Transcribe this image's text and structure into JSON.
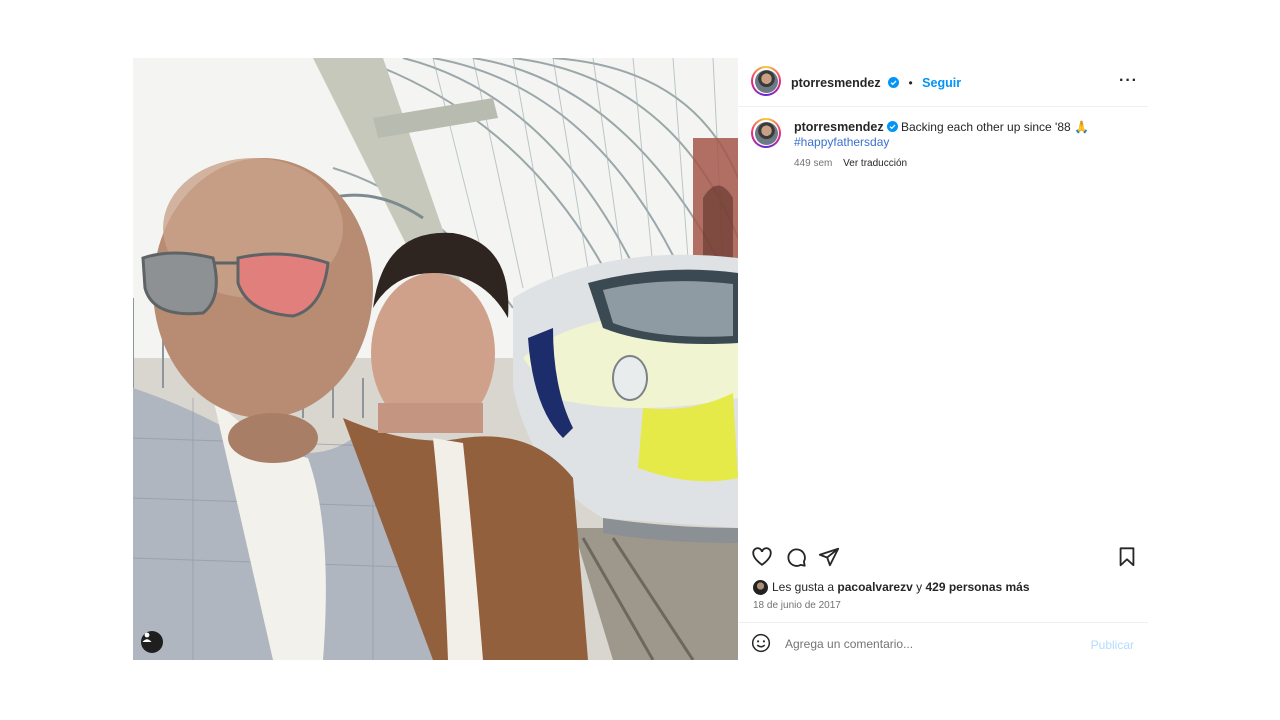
{
  "post": {
    "author": {
      "username": "ptorresmendez",
      "verified": true,
      "follow_label": "Seguir",
      "separator": "•"
    },
    "caption": {
      "text": "Backing each other up since '88 🙏",
      "hashtag": "#happyfathersday",
      "age": "449 sem",
      "translate_label": "Ver traducción"
    },
    "likes": {
      "prefix": "Les gusta a",
      "user": "paco​alvarezv",
      "conjunction": "y",
      "others": "429 personas más"
    },
    "date": "18 de junio de 2017",
    "comment": {
      "placeholder": "Agrega un comentario...",
      "publish_label": "Publicar"
    },
    "more_label": "···"
  },
  "icons": {
    "verified": "verified-badge-icon",
    "like": "heart-icon",
    "comment": "comment-icon",
    "share": "send-icon",
    "save": "bookmark-icon",
    "emoji": "emoji-icon",
    "tag": "user-tag-icon"
  },
  "colors": {
    "link": "#0095f6",
    "hashtag": "#3b6fd0",
    "publish_disabled": "#b3dbff",
    "muted": "#737373"
  }
}
